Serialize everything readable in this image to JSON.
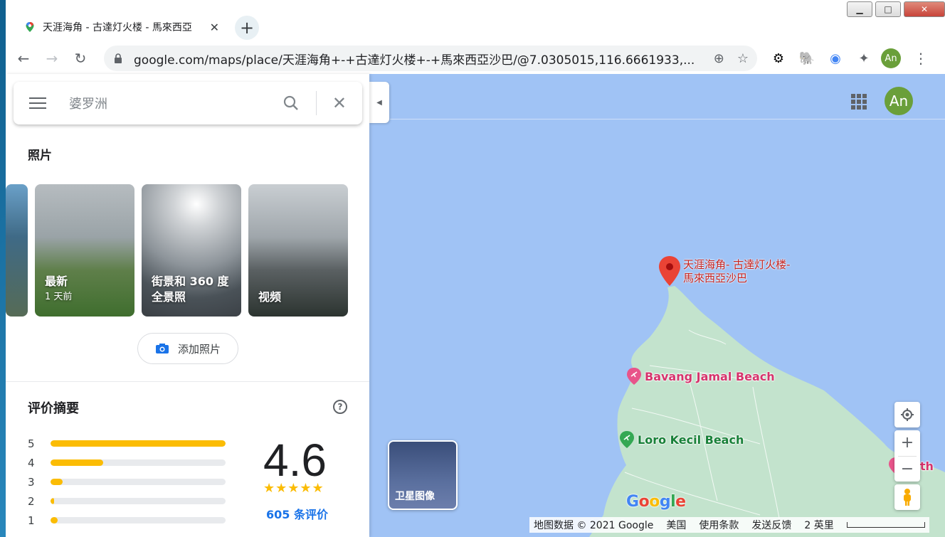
{
  "browser": {
    "tab_title": "天涯海角 - 古達灯火楼 - 馬來西亞",
    "tab_close": "✕",
    "new_tab": "+",
    "url": "google.com/maps/place/天涯海角+-+古達灯火楼+-+馬來西亞沙巴/@7.0305015,116.6661933,...",
    "profile_initials": "An",
    "window_controls": {
      "minimize": "▁",
      "maximize": "□",
      "close": "✕"
    }
  },
  "map": {
    "avatar_initials": "An",
    "pin_label": "天涯海角- 古達灯火楼- 馬來西亞沙巴",
    "pois": [
      {
        "name": "Bavang Jamal Beach",
        "color": "#d6336c"
      },
      {
        "name": "Loro Kecil Beach",
        "color": "#188038"
      },
      {
        "name": "orth",
        "color": "#d6336c"
      }
    ],
    "satellite_label": "卫星图像",
    "google_logo": "Google",
    "attribution": {
      "data": "地图数据 © 2021 Google",
      "region": "美国",
      "terms": "使用条款",
      "feedback": "发送反馈",
      "scale": "2 英里"
    },
    "colors": {
      "water": "#a0c3f5",
      "land": "#c3e3cd"
    }
  },
  "panel": {
    "search_placeholder": "婆罗洲",
    "photos_title": "照片",
    "photo_cards": [
      {
        "label": "",
        "sub": ""
      },
      {
        "label": "最新",
        "sub": "1 天前"
      },
      {
        "label": "街景和 360 度全景照",
        "sub": ""
      },
      {
        "label": "视频",
        "sub": ""
      }
    ],
    "add_photo_label": "添加照片",
    "review_title": "评价摘要",
    "rating_bars": [
      {
        "star": "5",
        "fraction": 1.0
      },
      {
        "star": "4",
        "fraction": 0.3
      },
      {
        "star": "3",
        "fraction": 0.07
      },
      {
        "star": "2",
        "fraction": 0.02
      },
      {
        "star": "1",
        "fraction": 0.04
      }
    ],
    "rating": "4.6",
    "stars": "★★★★★",
    "review_count": "605 条评价"
  }
}
